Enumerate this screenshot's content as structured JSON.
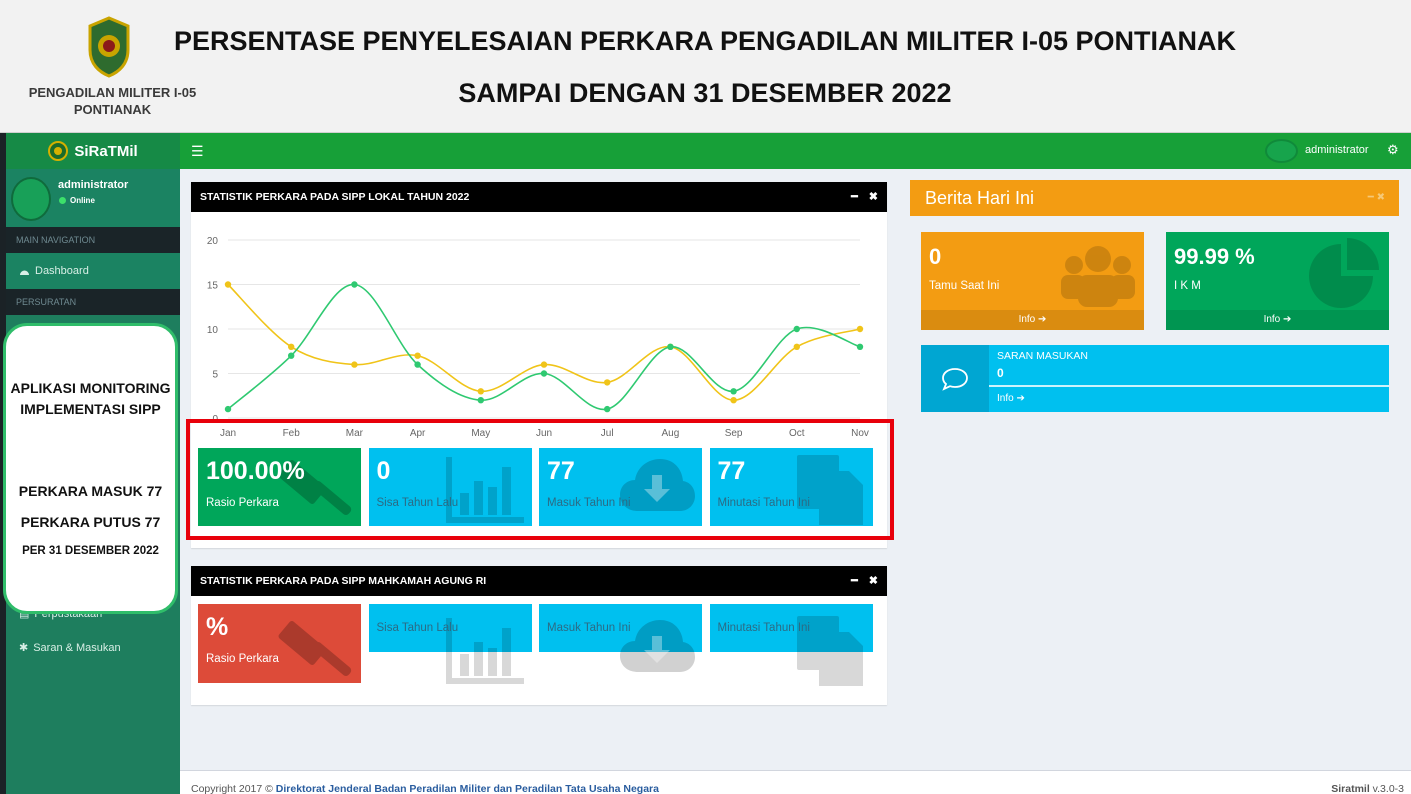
{
  "banner": {
    "court_name": "PENGADILAN MILITER I-05 PONTIANAK",
    "title_line1": "PERSENTASE PENYELESAIAN PERKARA PENGADILAN MILITER I-05 PONTIANAK",
    "title_line2": "SAMPAI DENGAN 31 DESEMBER 2022"
  },
  "sidebar": {
    "app_name": "SiRaTMil",
    "user_name": "administrator",
    "status": "Online",
    "nav_header": "MAIN NAVIGATION",
    "dashboard_label": "Dashboard",
    "section_header": "PERSURATAN",
    "perpustakaan_label": "Perpustakaan",
    "saran_label": "Saran & Masukan"
  },
  "overlay": {
    "line1": "APLIKASI MONITORING IMPLEMENTASI SIPP",
    "line2": "PERKARA MASUK 77",
    "line3": "PERKARA PUTUS 77",
    "line4": "PER 31 DESEMBER 2022"
  },
  "topnav": {
    "user_name": "administrator"
  },
  "box1": {
    "title": "STATISTIK PERKARA PADA SIPP LOKAL TAHUN 2022",
    "tiles": [
      {
        "value": "100.00%",
        "label": "Rasio Perkara",
        "color": "#00a65a",
        "icon": "gavel-icon"
      },
      {
        "value": "0",
        "label": "Sisa Tahun Lalu",
        "color": "#00c0ef",
        "icon": "bar-chart-icon"
      },
      {
        "value": "77",
        "label": "Masuk Tahun Ini",
        "color": "#00c0ef",
        "icon": "cloud-download-icon"
      },
      {
        "value": "77",
        "label": "Minutasi Tahun Ini",
        "color": "#00c0ef",
        "icon": "files-icon"
      }
    ]
  },
  "box2": {
    "title": "STATISTIK PERKARA PADA SIPP MAHKAMAH AGUNG RI",
    "tiles": [
      {
        "value": "%",
        "label": "Rasio Perkara",
        "color": "#dd4b39",
        "icon": "gavel-icon"
      },
      {
        "value": "",
        "label": "Sisa Tahun Lalu",
        "color": "#00c0ef",
        "icon": "bar-chart-icon"
      },
      {
        "value": "",
        "label": "Masuk Tahun Ini",
        "color": "#00c0ef",
        "icon": "cloud-download-icon"
      },
      {
        "value": "",
        "label": "Minutasi Tahun Ini",
        "color": "#00c0ef",
        "icon": "files-icon"
      }
    ]
  },
  "chart_data": {
    "type": "line",
    "categories": [
      "Jan",
      "Feb",
      "Mar",
      "Apr",
      "May",
      "Jun",
      "Jul",
      "Aug",
      "Sep",
      "Oct",
      "Nov"
    ],
    "series": [
      {
        "values": [
          1,
          7,
          15,
          6,
          2,
          5,
          1,
          8,
          3,
          10,
          8
        ],
        "color": "#2fc971"
      },
      {
        "values": [
          15,
          8,
          6,
          7,
          3,
          6,
          4,
          8,
          2,
          8,
          10
        ],
        "color": "#f0c419"
      }
    ],
    "yticks": [
      0,
      5,
      10,
      15,
      20
    ],
    "ylim": [
      0,
      20
    ],
    "grid": true
  },
  "right": {
    "berita_title": "Berita Hari Ini",
    "tamu": {
      "value": "0",
      "label": "Tamu Saat Ini",
      "info": "Info",
      "color": "#f39c12",
      "icon": "users-icon"
    },
    "ikm": {
      "value": "99.99 %",
      "label": "I K M",
      "info": "Info",
      "color": "#00a65a",
      "icon": "pie-chart-icon"
    },
    "saran": {
      "title": "SARAN MASUKAN",
      "value": "0",
      "info": "Info",
      "icon": "comment-icon"
    }
  },
  "footer": {
    "copyright": "Copyright 2017 ©",
    "org": "Direktorat Jenderal Badan Peradilan Militer dan Peradilan Tata Usaha Negara",
    "brand": "Siratmil",
    "version": "v.3.0-3"
  }
}
